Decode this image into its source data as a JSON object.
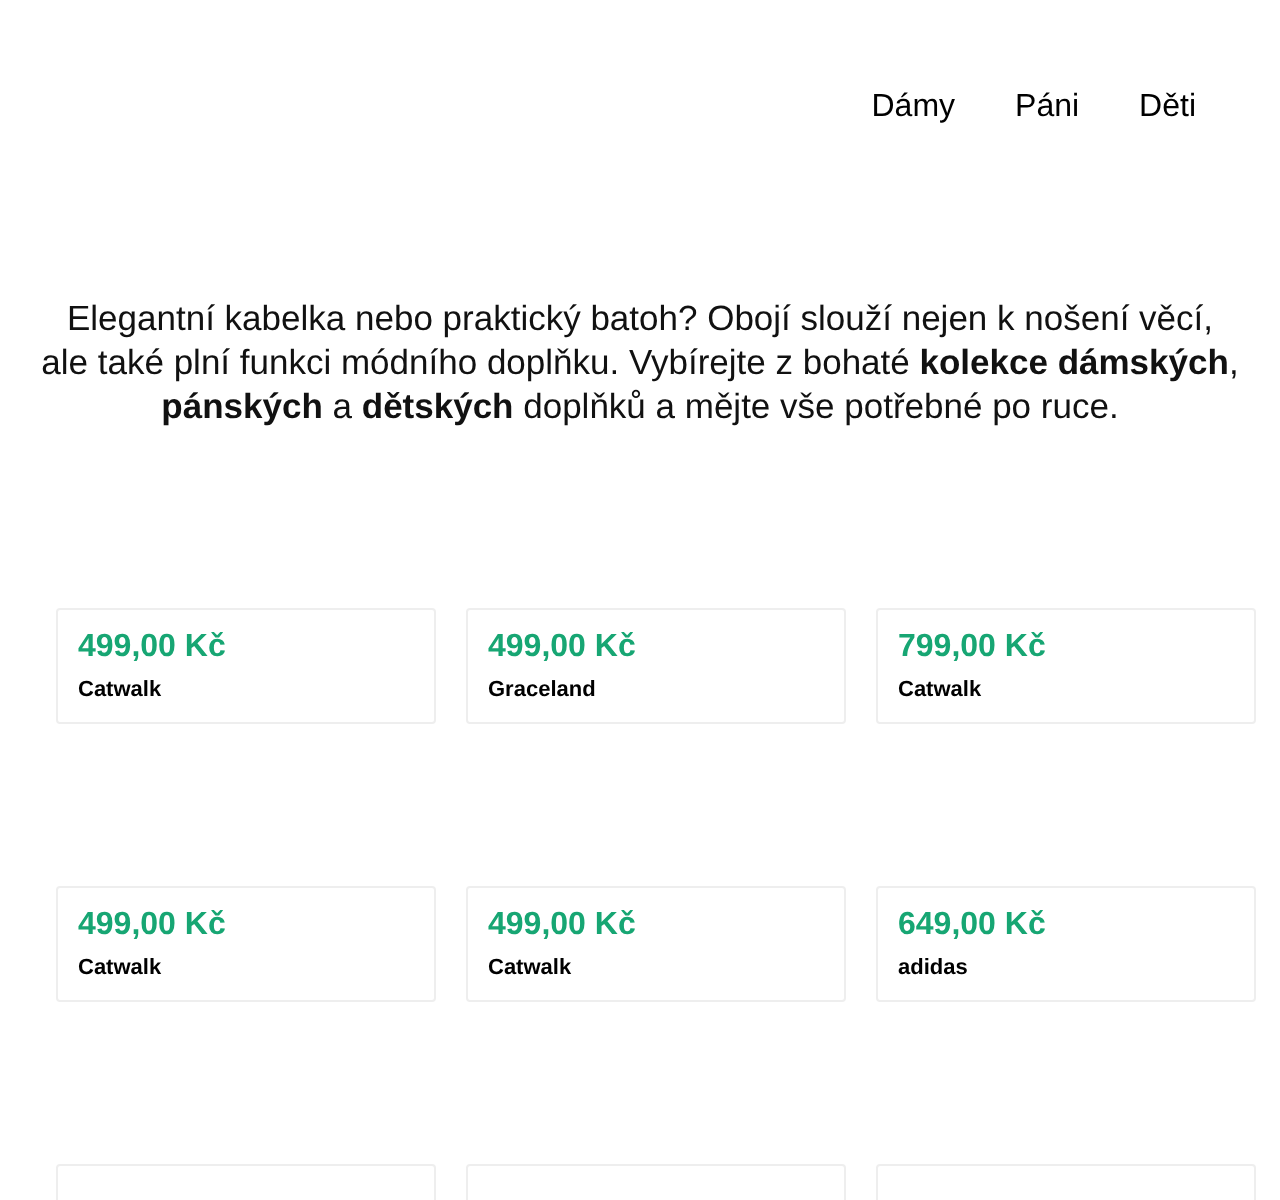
{
  "nav": {
    "items": [
      "Dámy",
      "Páni",
      "Děti"
    ]
  },
  "intro": "Elegantní kabelka nebo praktický batoh? Obojí slouží nejen k nošení věcí, ale také plní funkci módního doplňku. Vybírejte z bohaté **kolekce dámských**, **pánských** a **dětských** doplňků a mějte vše potřebné po ruce.",
  "products": [
    {
      "price": "499,00 Kč",
      "brand": "Catwalk"
    },
    {
      "price": "499,00 Kč",
      "brand": "Graceland"
    },
    {
      "price": "799,00 Kč",
      "brand": "Catwalk"
    },
    {
      "price": "499,00 Kč",
      "brand": "Catwalk"
    },
    {
      "price": "499,00 Kč",
      "brand": "Catwalk"
    },
    {
      "price": "649,00 Kč",
      "brand": "adidas"
    }
  ]
}
